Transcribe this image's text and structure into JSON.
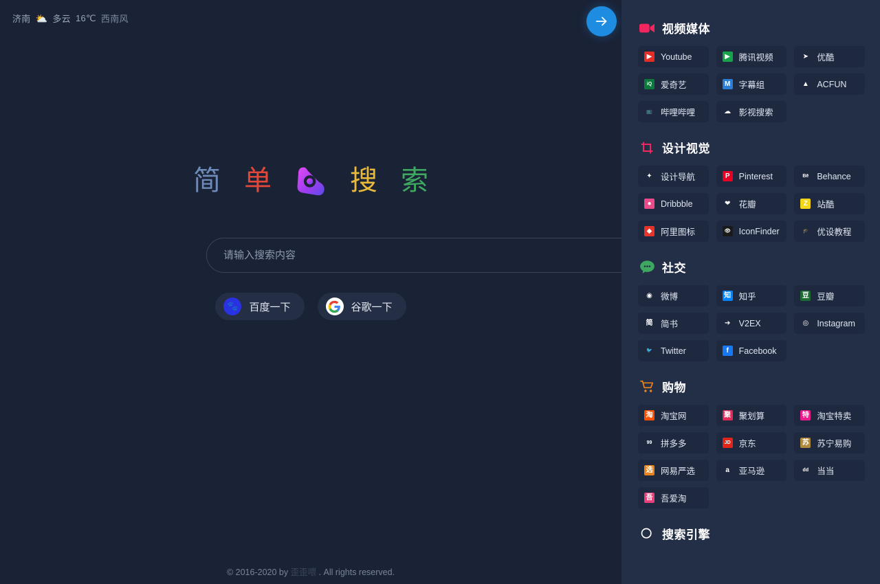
{
  "weather": {
    "city": "济南",
    "icon": "partly-cloudy-icon",
    "description": "多云",
    "temperature": "16℃",
    "wind": "西南风"
  },
  "arrow_button": {
    "name": "go-arrow-button",
    "icon": "arrow-right-icon"
  },
  "logo": {
    "chars": [
      {
        "text": "简",
        "color": "#6d8ab8"
      },
      {
        "text": "单",
        "color": "#e2483a"
      },
      {
        "text": "搜",
        "color": "#e8b93a"
      },
      {
        "text": "索",
        "color": "#3fa860"
      }
    ],
    "mark": {
      "name": "app-logo-icon",
      "from": "#d44bf0",
      "to": "#6b4bf0"
    }
  },
  "search": {
    "placeholder": "请输入搜索内容",
    "value": ""
  },
  "engines": [
    {
      "label": "百度一下",
      "icon": "baidu-icon",
      "color": "#2932e1"
    },
    {
      "label": "谷歌一下",
      "icon": "google-icon",
      "color": "#ffffff"
    }
  ],
  "footer": {
    "prefix": "© 2016-2020 by ",
    "author": "歪歪喂",
    "suffix": " . All rights reserved."
  },
  "sidebar": {
    "sections": [
      {
        "title": "视频媒体",
        "icon": "video-camera-icon",
        "icon_color": "#f0265e",
        "items": [
          {
            "label": "Youtube",
            "icon": "youtube-icon",
            "bg": "#e52d27",
            "glyph": "▶"
          },
          {
            "label": "腾讯视频",
            "icon": "tencent-video-icon",
            "bg": "#17a34a",
            "glyph": "▶"
          },
          {
            "label": "优酷",
            "icon": "youku-icon",
            "bg": "none",
            "glyph": "➤"
          },
          {
            "label": "爱奇艺",
            "icon": "iqiyi-icon",
            "bg": "#0b7a3c",
            "glyph": "iQ"
          },
          {
            "label": "字幕组",
            "icon": "zimuzu-icon",
            "bg": "#2a7fd4",
            "glyph": "M"
          },
          {
            "label": "ACFUN",
            "icon": "acfun-icon",
            "bg": "none",
            "glyph": "▲"
          },
          {
            "label": "哔哩哔哩",
            "icon": "bilibili-icon",
            "bg": "none",
            "glyph": "📺"
          },
          {
            "label": "影视搜索",
            "icon": "movie-search-icon",
            "bg": "none",
            "glyph": "☁"
          }
        ]
      },
      {
        "title": "设计视觉",
        "icon": "crop-icon",
        "icon_color": "#f0265e",
        "items": [
          {
            "label": "设计导航",
            "icon": "design-nav-icon",
            "bg": "none",
            "glyph": "✦"
          },
          {
            "label": "Pinterest",
            "icon": "pinterest-icon",
            "bg": "#e60023",
            "glyph": "P"
          },
          {
            "label": "Behance",
            "icon": "behance-icon",
            "bg": "none",
            "glyph": "Bē"
          },
          {
            "label": "Dribbble",
            "icon": "dribbble-icon",
            "bg": "#ea4c89",
            "glyph": "●"
          },
          {
            "label": "花瓣",
            "icon": "huaban-icon",
            "bg": "none",
            "glyph": "❤"
          },
          {
            "label": "站酷",
            "icon": "zcool-icon",
            "bg": "#f4d71a",
            "glyph": "Z"
          },
          {
            "label": "阿里图标",
            "icon": "iconfont-icon",
            "bg": "#e8332a",
            "glyph": "◆"
          },
          {
            "label": "IconFinder",
            "icon": "iconfinder-icon",
            "bg": "#1a1a1a",
            "glyph": "👁"
          },
          {
            "label": "优设教程",
            "icon": "uisdc-icon",
            "bg": "none",
            "glyph": "🎓"
          }
        ]
      },
      {
        "title": "社交",
        "icon": "chat-bubble-icon",
        "icon_color": "#3fa860",
        "items": [
          {
            "label": "微博",
            "icon": "weibo-icon",
            "bg": "none",
            "glyph": "◉"
          },
          {
            "label": "知乎",
            "icon": "zhihu-icon",
            "bg": "#0084ff",
            "glyph": "知"
          },
          {
            "label": "豆瓣",
            "icon": "douban-icon",
            "bg": "#1d6b33",
            "glyph": "豆"
          },
          {
            "label": "简书",
            "icon": "jianshu-icon",
            "bg": "none",
            "glyph": "简"
          },
          {
            "label": "V2EX",
            "icon": "v2ex-icon",
            "bg": "none",
            "glyph": "➔"
          },
          {
            "label": "Instagram",
            "icon": "instagram-icon",
            "bg": "none",
            "glyph": "◎"
          },
          {
            "label": "Twitter",
            "icon": "twitter-icon",
            "bg": "none",
            "glyph": "🐦"
          },
          {
            "label": "Facebook",
            "icon": "facebook-icon",
            "bg": "#1877f2",
            "glyph": "f"
          }
        ]
      },
      {
        "title": "购物",
        "icon": "shopping-cart-icon",
        "icon_color": "#e8821a",
        "items": [
          {
            "label": "淘宝网",
            "icon": "taobao-icon",
            "bg": "#ff5000",
            "glyph": "淘"
          },
          {
            "label": "聚划算",
            "icon": "juhuasuan-icon",
            "bg": "#e02a5a",
            "glyph": "聚"
          },
          {
            "label": "淘宝特卖",
            "icon": "taobao-sale-icon",
            "bg": "#e91e8c",
            "glyph": "特"
          },
          {
            "label": "拼多多",
            "icon": "pinduoduo-icon",
            "bg": "none",
            "glyph": "99"
          },
          {
            "label": "京东",
            "icon": "jd-icon",
            "bg": "#e1251b",
            "glyph": "JD"
          },
          {
            "label": "苏宁易购",
            "icon": "suning-icon",
            "bg": "#b08a3c",
            "glyph": "苏"
          },
          {
            "label": "网易严选",
            "icon": "yanxuan-icon",
            "bg": "#e8821a",
            "glyph": "选"
          },
          {
            "label": "亚马逊",
            "icon": "amazon-icon",
            "bg": "none",
            "glyph": "a"
          },
          {
            "label": "当当",
            "icon": "dangdang-icon",
            "bg": "none",
            "glyph": "dd"
          },
          {
            "label": "吾爱淘",
            "icon": "wuaitao-icon",
            "bg": "#e8407a",
            "glyph": "吾"
          }
        ]
      },
      {
        "title": "搜索引擎",
        "icon": "search-circle-icon",
        "icon_color": "#ffffff",
        "items": []
      }
    ]
  }
}
